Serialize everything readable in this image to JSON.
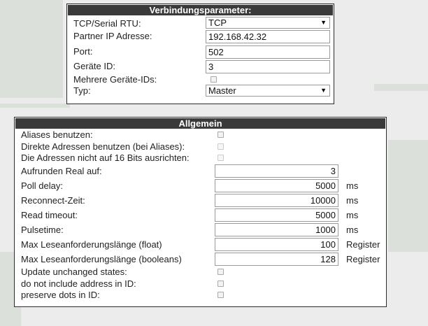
{
  "connection": {
    "title": "Verbindungsparameter:",
    "tcp_serial_label": "TCP/Serial RTU:",
    "tcp_serial_value": "TCP",
    "partner_ip_label": "Partner IP Adresse:",
    "partner_ip_value": "192.168.42.32",
    "port_label": "Port:",
    "port_value": "502",
    "device_id_label": "Geräte ID:",
    "device_id_value": "3",
    "multi_ids_label": "Mehrere Geräte-IDs:",
    "multi_ids_checked": false,
    "type_label": "Typ:",
    "type_value": "Master"
  },
  "general": {
    "title": "Allgemein",
    "use_aliases_label": "Aliases benutzen:",
    "direct_addresses_label": "Direkte Adressen benutzen (bei Aliases):",
    "align16_label": "Die Adressen nicht auf 16 Bits ausrichten:",
    "round_real_label": "Aufrunden Real auf:",
    "round_real_value": "3",
    "poll_delay_label": "Poll delay:",
    "poll_delay_value": "5000",
    "poll_delay_unit": "ms",
    "reconnect_label": "Reconnect-Zeit:",
    "reconnect_value": "10000",
    "reconnect_unit": "ms",
    "read_timeout_label": "Read timeout:",
    "read_timeout_value": "5000",
    "read_timeout_unit": "ms",
    "pulsetime_label": "Pulsetime:",
    "pulsetime_value": "1000",
    "pulsetime_unit": "ms",
    "max_float_label": "Max Leseanforderungslänge (float)",
    "max_float_value": "100",
    "max_float_unit": "Register",
    "max_bool_label": "Max Leseanforderungslänge (booleans)",
    "max_bool_value": "128",
    "max_bool_unit": "Register",
    "update_unchanged_label": "Update unchanged states:",
    "no_address_label": "do not include address in ID:",
    "preserve_dots_label": "preserve dots in ID:"
  },
  "colors": {
    "header_bg": "#3a3a3a",
    "header_text": "#ffffff",
    "page_bg": "#ececec"
  }
}
